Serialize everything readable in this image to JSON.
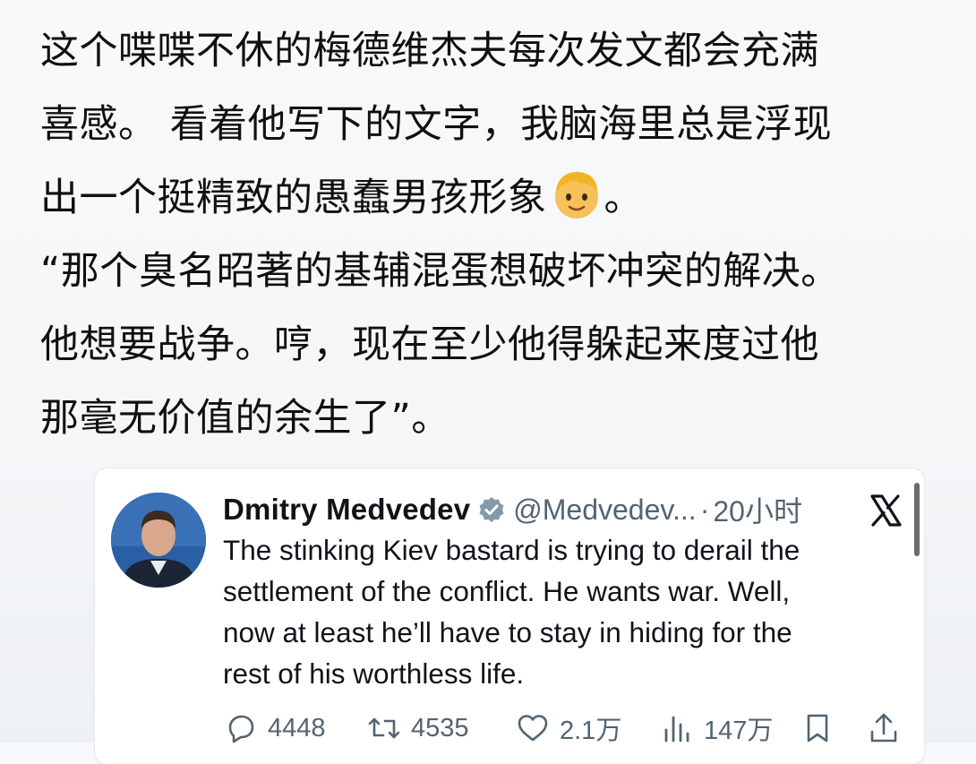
{
  "post": {
    "lines": [
      "这个喋喋不休的梅德维杰夫每次发文都会充满",
      "喜感。 看着他写下的文字，我脑海里总是浮现",
      "出一个挺精致的愚蠢男孩形象",
      "“那个臭名昭著的基辅混蛋想破坏冲突的解决。",
      "他想要战争。哼，现在至少他得躲起来度过他",
      "那毫无价值的余生了”。"
    ],
    "line3_suffix": "。",
    "emoji": "boy-face-emoji"
  },
  "tweet": {
    "display_name": "Dmitry Medvedev",
    "handle": "@Medvedev...",
    "separator": "·",
    "timestamp": "20小时",
    "body_lines": [
      "The stinking Kiev bastard is trying to derail the",
      "settlement of the conflict. He wants war. Well,",
      "now at least he’ll have to stay in hiding for the",
      "rest of his worthless life."
    ],
    "actions": {
      "replies": "4448",
      "retweets": "4535",
      "likes": "2.1万",
      "views": "147万"
    }
  },
  "colors": {
    "text_primary": "#0f1419",
    "text_secondary": "#536471",
    "verified": "#829aab",
    "avatar_bg": "#2a5fa5",
    "page_bg": "#f5f7f9"
  },
  "icons": [
    "boy-face-emoji",
    "verified-badge-icon",
    "x-logo-icon",
    "reply-icon",
    "retweet-icon",
    "like-icon",
    "views-icon",
    "bookmark-icon",
    "share-icon"
  ]
}
